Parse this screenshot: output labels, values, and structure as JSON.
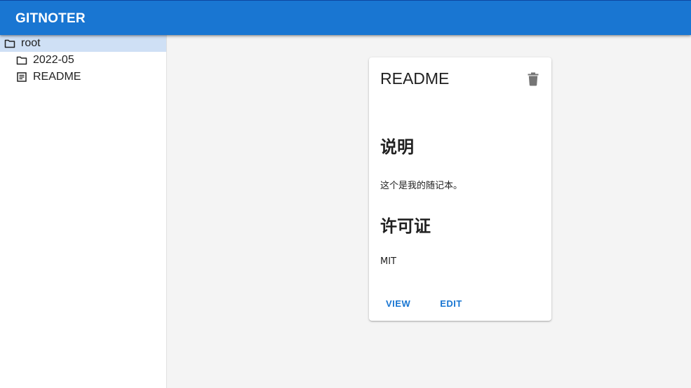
{
  "app": {
    "title": "GITNOTER"
  },
  "sidebar": {
    "items": [
      {
        "label": "root",
        "icon": "folder-icon",
        "selected": true
      },
      {
        "label": "2022-05",
        "icon": "folder-icon",
        "selected": false
      },
      {
        "label": "README",
        "icon": "document-icon",
        "selected": false
      }
    ]
  },
  "card": {
    "title": "README",
    "delete_icon": "trash-icon",
    "content": {
      "heading1": "说明",
      "paragraph1": "这个是我的随记本。",
      "heading2": "许可证",
      "paragraph2": "MIT"
    },
    "actions": {
      "view_label": "VIEW",
      "edit_label": "EDIT"
    }
  },
  "colors": {
    "primary": "#1976d2",
    "selected_bg": "#cfe0f5",
    "background": "#f4f4f4"
  }
}
